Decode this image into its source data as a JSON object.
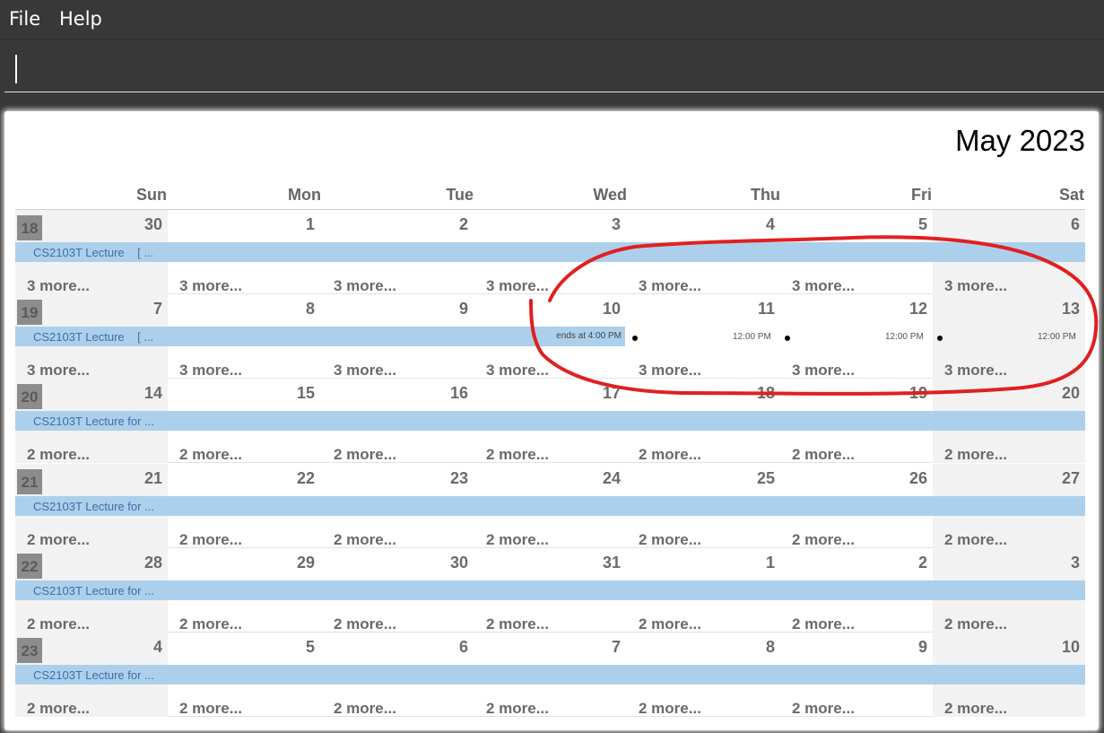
{
  "menu": {
    "file": "File",
    "help": "Help"
  },
  "command": {
    "value": ""
  },
  "calendar": {
    "title": "May 2023",
    "days": [
      "Sun",
      "Mon",
      "Tue",
      "Wed",
      "Thu",
      "Fri",
      "Sat"
    ],
    "weeks": [
      {
        "num": "18",
        "dates": [
          "30",
          "1",
          "2",
          "3",
          "4",
          "5",
          "6"
        ],
        "event": "CS2103T Lecture    [ ...",
        "more": [
          "3 more...",
          "3 more...",
          "3 more...",
          "3 more...",
          "3 more...",
          "3 more...",
          "3 more..."
        ]
      },
      {
        "num": "19",
        "dates": [
          "7",
          "8",
          "9",
          "10",
          "11",
          "12",
          "13"
        ],
        "event": "CS2103T Lecture    [ ...",
        "more": [
          "3 more...",
          "3 more...",
          "3 more...",
          "3 more...",
          "3 more...",
          "3 more...",
          "3 more..."
        ],
        "ends_at": "ends at 4:00 PM",
        "times": [
          "12:00 PM",
          "12:00 PM",
          "12:00 PM"
        ]
      },
      {
        "num": "20",
        "dates": [
          "14",
          "15",
          "16",
          "17",
          "18",
          "19",
          "20"
        ],
        "event": "CS2103T Lecture for ...",
        "more": [
          "2 more...",
          "2 more...",
          "2 more...",
          "2 more...",
          "2 more...",
          "2 more...",
          "2 more..."
        ]
      },
      {
        "num": "21",
        "dates": [
          "21",
          "22",
          "23",
          "24",
          "25",
          "26",
          "27"
        ],
        "event": "CS2103T Lecture for ...",
        "more": [
          "2 more...",
          "2 more...",
          "2 more...",
          "2 more...",
          "2 more...",
          "2 more...",
          "2 more..."
        ]
      },
      {
        "num": "22",
        "dates": [
          "28",
          "29",
          "30",
          "31",
          "1",
          "2",
          "3"
        ],
        "event": "CS2103T Lecture for ...",
        "more": [
          "2 more...",
          "2 more...",
          "2 more...",
          "2 more...",
          "2 more...",
          "2 more...",
          "2 more..."
        ]
      },
      {
        "num": "23",
        "dates": [
          "4",
          "5",
          "6",
          "7",
          "8",
          "9",
          "10"
        ],
        "event": "CS2103T Lecture for ...",
        "more": [
          "2 more...",
          "2 more...",
          "2 more...",
          "2 more...",
          "2 more...",
          "2 more...",
          "2 more..."
        ]
      }
    ]
  },
  "colors": {
    "event_bar": "#acd0ec",
    "weekend_shade": "#f2f2f2",
    "annotation": "#e02020"
  }
}
